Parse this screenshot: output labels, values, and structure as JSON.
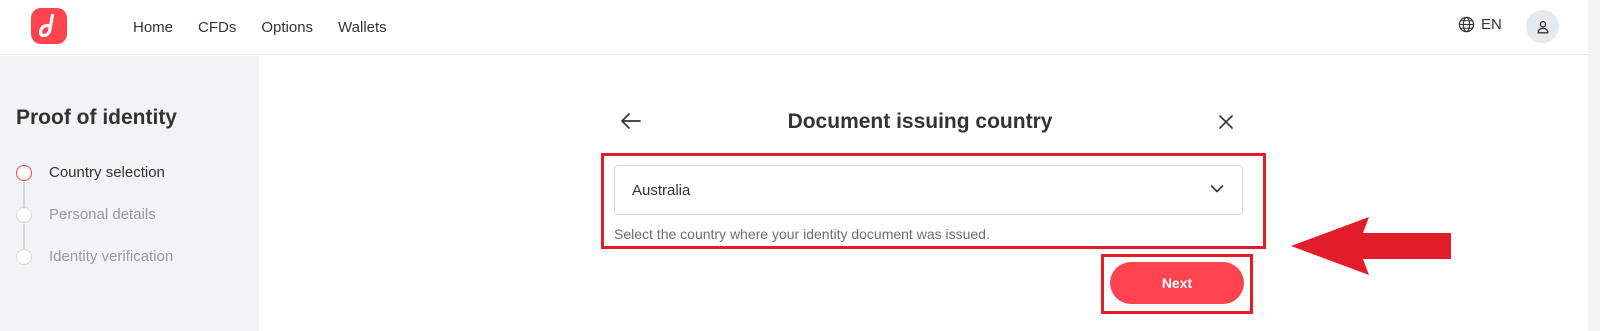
{
  "nav": {
    "items": [
      "Home",
      "CFDs",
      "Options",
      "Wallets"
    ],
    "language": "EN",
    "language_icon": "globe-icon",
    "account_icon": "user-icon"
  },
  "sidebar": {
    "title": "Proof of identity",
    "steps": [
      {
        "label": "Country selection",
        "active": true
      },
      {
        "label": "Personal details",
        "active": false
      },
      {
        "label": "Identity verification",
        "active": false
      }
    ]
  },
  "dialog": {
    "title": "Document issuing country",
    "country_select": {
      "value": "Australia"
    },
    "hint": "Select the country where your identity document was issued.",
    "next_label": "Next"
  },
  "colors": {
    "brand": "#ff444f",
    "annotation": "#e11d2a"
  }
}
